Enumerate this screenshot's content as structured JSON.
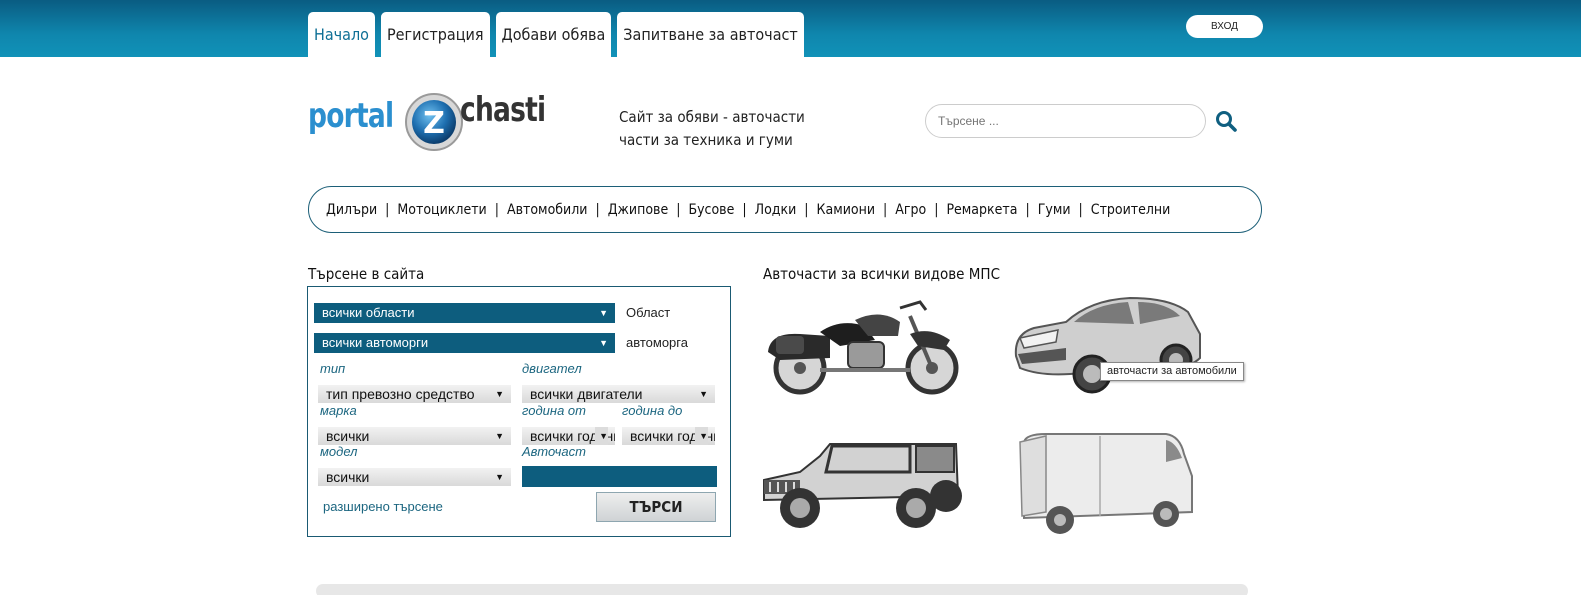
{
  "nav": {
    "tabs": [
      "Начало",
      "Регистрация",
      "Добави обява",
      "Запитване за авточаст"
    ],
    "login": "ВХОД"
  },
  "logo": {
    "left": "portal",
    "badge": "Z",
    "right": "chasti"
  },
  "tagline": {
    "line1": "Сайт за обяви - авточасти",
    "line2": "части за техника и гуми"
  },
  "search": {
    "placeholder": "Търсене ..."
  },
  "categories": [
    "Дилъри",
    "Мотоциклети",
    "Автомобили",
    "Джипове",
    "Бусове",
    "Лодки",
    "Камиони",
    "Агро",
    "Ремаркета",
    "Гуми",
    "Строителни"
  ],
  "search_panel": {
    "title": "Търсене в сайта",
    "region_value": "всички области",
    "region_label": "Област",
    "yard_value": "всички автоморги",
    "yard_label": "автоморга",
    "type_label": "тип",
    "type_value": "тип превозно средство",
    "engine_label": "двигател",
    "engine_value": "всички двигатели",
    "make_label": "марка",
    "make_value": "всички",
    "year_from_label": "година от",
    "year_from_value": "всички години",
    "year_to_label": "година до",
    "year_to_value": "всички години",
    "model_label": "модел",
    "model_value": "всички",
    "part_label": "Авточаст",
    "advanced": "разширено търсене",
    "submit": "ТЪРСИ"
  },
  "vehicles": {
    "title": "Авточасти за всички видове МПС",
    "tooltip": "авточасти за автомобили"
  }
}
